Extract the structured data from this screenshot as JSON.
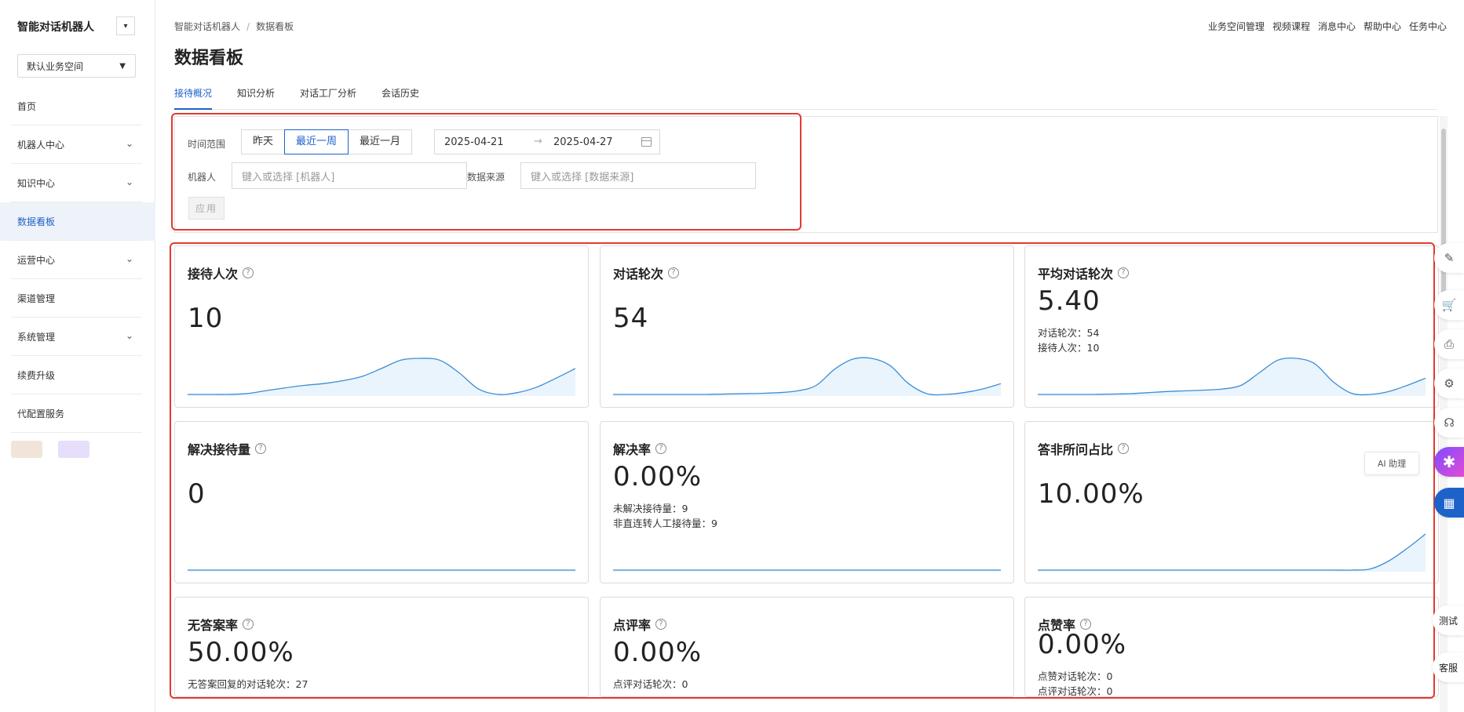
{
  "sidebar": {
    "brand": "智能对话机器人",
    "toggle_icon": "▾",
    "workspace": "默认业务空间",
    "items": [
      {
        "label": "首页",
        "has_children": false,
        "active": false
      },
      {
        "label": "机器人中心",
        "has_children": true,
        "active": false
      },
      {
        "label": "知识中心",
        "has_children": true,
        "active": false
      },
      {
        "label": "数据看板",
        "has_children": false,
        "active": true
      },
      {
        "label": "运营中心",
        "has_children": true,
        "active": false
      },
      {
        "label": "渠道管理",
        "has_children": false,
        "active": false
      },
      {
        "label": "系统管理",
        "has_children": true,
        "active": false
      },
      {
        "label": "续费升级",
        "has_children": false,
        "active": false
      },
      {
        "label": "代配置服务",
        "has_children": false,
        "active": false
      }
    ]
  },
  "header": {
    "breadcrumb": [
      "智能对话机器人",
      "数据看板"
    ],
    "breadcrumb_sep": "/",
    "links": [
      "业务空间管理",
      "视频课程",
      "消息中心",
      "帮助中心",
      "任务中心"
    ],
    "title": "数据看板"
  },
  "tabs": [
    "接待概况",
    "知识分析",
    "对话工厂分析",
    "会话历史"
  ],
  "active_tab": 0,
  "filters": {
    "time_label": "时间范围",
    "ranges": [
      "昨天",
      "最近一周",
      "最近一月"
    ],
    "selected_range": 1,
    "start_date": "2025-04-21",
    "range_arrow": "→",
    "end_date": "2025-04-27",
    "robot_label": "机器人",
    "robot_placeholder": "键入或选择 [机器人]",
    "source_label": "数据来源",
    "source_placeholder": "键入或选择 [数据来源]",
    "apply_label": "应用"
  },
  "cards": [
    {
      "title": "接待人次",
      "value": "10",
      "sub": [],
      "spark": [
        0,
        0,
        0,
        0.02,
        0.1,
        0.18,
        0.25,
        0.3,
        0.38,
        0.5,
        0.72,
        0.95,
        1,
        0.95,
        0.6,
        0.15,
        0,
        0.05,
        0.2,
        0.45,
        0.72
      ]
    },
    {
      "title": "对话轮次",
      "value": "54",
      "sub": [],
      "spark": [
        0,
        0,
        0,
        0,
        0,
        0,
        0.01,
        0.02,
        0.03,
        0.05,
        0.1,
        0.25,
        0.7,
        0.98,
        1,
        0.8,
        0.3,
        0.02,
        0,
        0.05,
        0.15,
        0.3
      ]
    },
    {
      "title": "平均对话轮次",
      "value": "5.40",
      "sub": [
        "对话轮次：54",
        "接待人次：10"
      ],
      "spark": [
        0,
        0,
        0,
        0,
        0.01,
        0.02,
        0.05,
        0.08,
        0.1,
        0.12,
        0.15,
        0.25,
        0.6,
        0.95,
        1,
        0.85,
        0.35,
        0.03,
        0,
        0.08,
        0.25,
        0.45
      ]
    },
    {
      "title": "解决接待量",
      "value": "0",
      "sub": [],
      "spark": [
        0,
        0,
        0,
        0,
        0,
        0,
        0,
        0,
        0,
        0,
        0,
        0,
        0,
        0,
        0,
        0,
        0,
        0,
        0,
        0,
        0,
        0
      ]
    },
    {
      "title": "解决率",
      "value": "0.00%",
      "sub": [
        "未解决接待量：9",
        "非直连转人工接待量：9"
      ],
      "spark": [
        0,
        0,
        0,
        0,
        0,
        0,
        0,
        0,
        0,
        0,
        0,
        0,
        0,
        0,
        0,
        0,
        0,
        0,
        0,
        0,
        0,
        0
      ]
    },
    {
      "title": "答非所问占比",
      "value": "10.00%",
      "sub": [],
      "spark": [
        0,
        0,
        0,
        0,
        0,
        0,
        0,
        0,
        0,
        0,
        0,
        0,
        0,
        0,
        0,
        0,
        0,
        0,
        0.03,
        0.25,
        0.6,
        1
      ]
    },
    {
      "title": "无答案率",
      "value": "50.00%",
      "sub": [
        "无答案回复的对话轮次：27"
      ],
      "spark": []
    },
    {
      "title": "点评率",
      "value": "0.00%",
      "sub": [
        "点评对话轮次：0"
      ],
      "spark": []
    },
    {
      "title": "点赞率",
      "value": "0.00%",
      "sub": [
        "点赞对话轮次：0",
        "点评对话轮次：0"
      ],
      "spark": []
    }
  ],
  "help_icon": "?",
  "side_tools": [
    {
      "name": "edit-icon",
      "glyph": "✎"
    },
    {
      "name": "cart-icon",
      "glyph": "🛒"
    },
    {
      "name": "api-icon",
      "glyph": "⎙"
    },
    {
      "name": "settings-icon",
      "glyph": "⚙"
    },
    {
      "name": "headset-icon",
      "glyph": "☊"
    },
    {
      "name": "ai-assistant-icon",
      "glyph": "✱"
    },
    {
      "name": "apps-icon",
      "glyph": "▦"
    }
  ],
  "ai_tip": "AI 助理",
  "test_label": "测试",
  "service_label": "客服",
  "colors": {
    "accent": "#1d62c9",
    "spark_line": "#3b8ed6",
    "spark_fill": "#eaf4fc",
    "annotation": "#e23b2e"
  }
}
